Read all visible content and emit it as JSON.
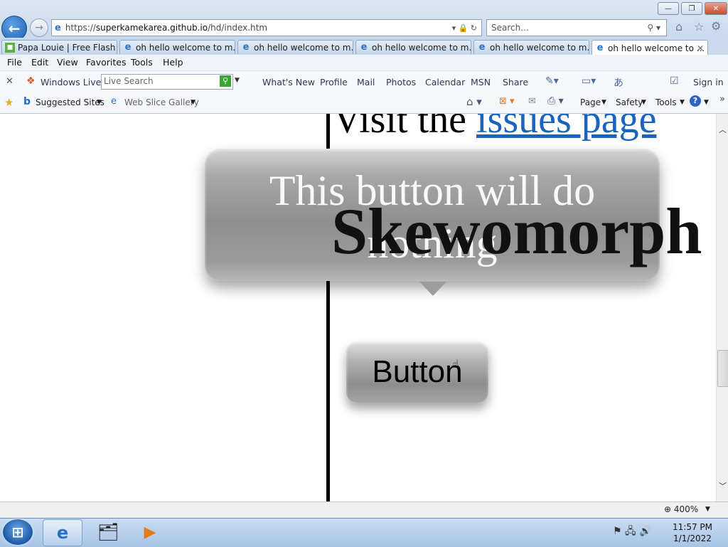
{
  "browser": {
    "address": "https://superkamekarea.github.io/hd/index.htm",
    "address_prefix": "https://",
    "address_host": "superkamekarea.github.io",
    "address_path": "/hd/index.htm",
    "search_placeholder": "Search...",
    "window_buttons": {
      "minimize": "—",
      "restore": "❐",
      "close": "✕"
    }
  },
  "tabs": [
    {
      "label": "Papa Louie | Free Flash ...",
      "icon": "game-icon"
    },
    {
      "label": "oh hello welcome to m...",
      "icon": "ie-icon"
    },
    {
      "label": "oh hello welcome to m...",
      "icon": "ie-icon"
    },
    {
      "label": "oh hello welcome to m...",
      "icon": "ie-icon"
    },
    {
      "label": "oh hello welcome to m...",
      "icon": "ie-icon"
    },
    {
      "label": "oh hello welcome to ...",
      "icon": "ie-icon",
      "active": true
    }
  ],
  "menu": [
    "File",
    "Edit",
    "View",
    "Favorites",
    "Tools",
    "Help"
  ],
  "toolbar": {
    "windows_live": "Windows Live",
    "live_search_placeholder": "Live Search",
    "links": [
      "What's New",
      "Profile",
      "Mail",
      "Photos",
      "Calendar",
      "MSN",
      "Share"
    ],
    "sign_in": "Sign in"
  },
  "favorites": {
    "suggested_sites": "Suggested Sites",
    "web_slice_gallery": "Web Slice Gallery",
    "commands": [
      "Page",
      "Safety",
      "Tools"
    ]
  },
  "page": {
    "visit_text": "Visit the ",
    "issues_link": "issues page",
    "big_button_text": "This button will do nothing",
    "heading": "Skewomorph",
    "small_button": "Button"
  },
  "status": {
    "zoom": "400%"
  },
  "taskbar": {
    "time": "11:57 PM",
    "date": "1/1/2022"
  },
  "colors": {
    "link": "#1a64c0",
    "accent": "#2a73c5"
  }
}
